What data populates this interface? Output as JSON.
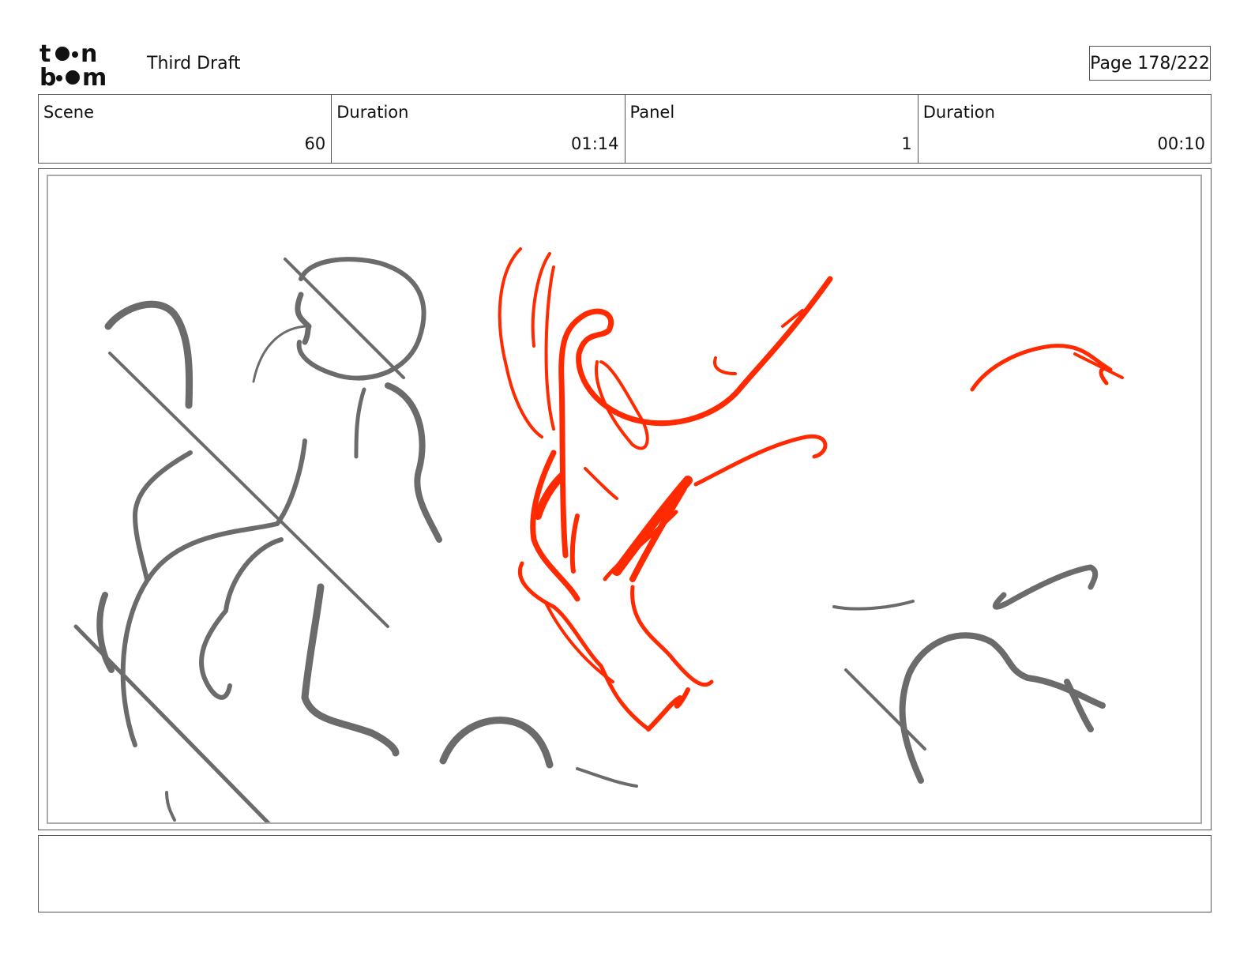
{
  "header": {
    "logo": "toon boom",
    "draft_title": "Third Draft",
    "page_label": "Page 178/222"
  },
  "info": {
    "scene_label": "Scene",
    "scene_value": "60",
    "scene_duration_label": "Duration",
    "scene_duration_value": "01:14",
    "panel_label": "Panel",
    "panel_value": "1",
    "panel_duration_label": "Duration",
    "panel_duration_value": "00:10"
  },
  "panel": {
    "sketch_color": "#6b6b6b",
    "accent_color": "#ff2a00"
  },
  "notes": {
    "text": ""
  }
}
